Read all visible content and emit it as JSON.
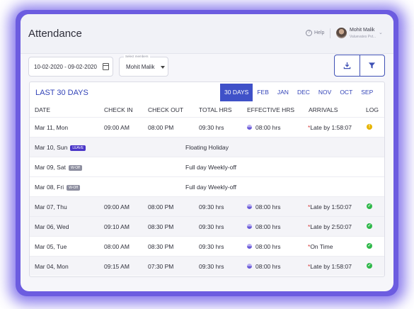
{
  "header": {
    "title": "Attendance",
    "help_label": "Help",
    "user_name": "Mohit Malik",
    "user_org": "Valuevates Pvt..."
  },
  "filters": {
    "date_range": "10-02-2020 - 09-02-2020",
    "members_label": "Select members",
    "member_value": "Mohit Malik"
  },
  "card": {
    "title": "LAST 30 DAYS",
    "months": [
      "30 DAYS",
      "FEB",
      "JAN",
      "DEC",
      "NOV",
      "OCT",
      "SEP"
    ],
    "active_month": "30 DAYS",
    "columns": [
      "DATE",
      "CHECK IN",
      "CHECK OUT",
      "TOTAL HRS",
      "EFFECTIVE HRS",
      "ARRIVALS",
      "LOG"
    ]
  },
  "rows": [
    {
      "date": "Mar 11, Mon",
      "check_in": "09:00 AM",
      "check_out": "08:00 PM",
      "total": "09:30 hrs",
      "effective": "08:00 hrs",
      "arrival": "Late by 1:58:07",
      "log": "warning"
    },
    {
      "date": "Mar 10, Sun",
      "badge": "LEAVE",
      "note": "Floating Holiday"
    },
    {
      "date": "Mar 09, Sat",
      "badge": "W-Off",
      "note": "Full day Weekly-off"
    },
    {
      "date": "Mar 08, Fri",
      "badge": "W-Off",
      "note": "Full day Weekly-off"
    },
    {
      "date": "Mar 07, Thu",
      "check_in": "09:00 AM",
      "check_out": "08:00 PM",
      "total": "09:30 hrs",
      "effective": "08:00 hrs",
      "arrival": "Late by 1:50:07",
      "log": "ok"
    },
    {
      "date": "Mar 06, Wed",
      "check_in": "09:10 AM",
      "check_out": "08:30 PM",
      "total": "09:30 hrs",
      "effective": "08:00 hrs",
      "arrival": "Late by 2:50:07",
      "log": "ok"
    },
    {
      "date": "Mar 05, Tue",
      "check_in": "08:00 AM",
      "check_out": "08:30 PM",
      "total": "09:30 hrs",
      "effective": "08:00 hrs",
      "arrival": "On Time",
      "log": "ok"
    },
    {
      "date": "Mar 04, Mon",
      "check_in": "09:15 AM",
      "check_out": "07:30 PM",
      "total": "09:30 hrs",
      "effective": "08:00 hrs",
      "arrival": "Late by 1:58:07",
      "log": "ok"
    }
  ],
  "colors": {
    "frame": "#6c5ce0",
    "accent": "#3f51c8",
    "leave_badge": "#4a36c8",
    "woff_badge": "#8e8fa0",
    "ok": "#2fb84a",
    "warning": "#e6b400"
  },
  "icons": {
    "date_picker": "calendar-icon",
    "download": "download-icon",
    "filter": "filter-icon",
    "log_ok": "check-circle-icon",
    "log_warning": "exclamation-circle-icon"
  }
}
